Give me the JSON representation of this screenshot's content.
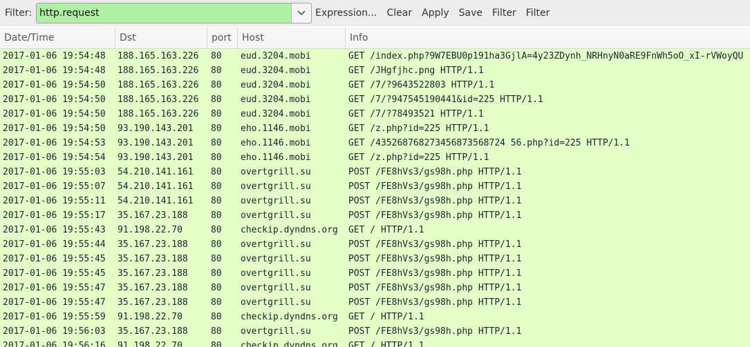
{
  "toolbar": {
    "filter_label": "Filter:",
    "filter_value": "http.request",
    "buttons": [
      "Expression...",
      "Clear",
      "Apply",
      "Save",
      "Filter",
      "Filter"
    ]
  },
  "columns": [
    "Date/Time",
    "Dst",
    "port",
    "Host",
    "Info"
  ],
  "rows": [
    [
      "2017-01-06 19:54:48",
      "188.165.163.226",
      "80",
      "eud.3204.mobi",
      "GET /index.php?9W7EBU0p191ha3GjlA=4y23ZDynh_NRHnyN0aRE9FnWh5oO_xI-rVWoyQU"
    ],
    [
      "2017-01-06 19:54:48",
      "188.165.163.226",
      "80",
      "eud.3204.mobi",
      "GET /JHgfjhc.png HTTP/1.1"
    ],
    [
      "2017-01-06 19:54:50",
      "188.165.163.226",
      "80",
      "eud.3204.mobi",
      "GET /7/?9643522803 HTTP/1.1"
    ],
    [
      "2017-01-06 19:54:50",
      "188.165.163.226",
      "80",
      "eud.3204.mobi",
      "GET /7/?947545190441&id=225 HTTP/1.1"
    ],
    [
      "2017-01-06 19:54:50",
      "188.165.163.226",
      "80",
      "eud.3204.mobi",
      "GET /7/?78493521 HTTP/1.1"
    ],
    [
      "2017-01-06 19:54:50",
      "93.190.143.201",
      "80",
      "eho.1146.mobi",
      "GET /z.php?id=225 HTTP/1.1"
    ],
    [
      "2017-01-06 19:54:53",
      "93.190.143.201",
      "80",
      "eho.1146.mobi",
      "GET /435268768273456873568724 56.php?id=225 HTTP/1.1"
    ],
    [
      "2017-01-06 19:54:54",
      "93.190.143.201",
      "80",
      "eho.1146.mobi",
      "GET /z.php?id=225 HTTP/1.1"
    ],
    [
      "2017-01-06 19:55:03",
      "54.210.141.161",
      "80",
      "overtgrill.su",
      "POST /FE8hVs3/gs98h.php HTTP/1.1"
    ],
    [
      "2017-01-06 19:55:07",
      "54.210.141.161",
      "80",
      "overtgrill.su",
      "POST /FE8hVs3/gs98h.php HTTP/1.1"
    ],
    [
      "2017-01-06 19:55:11",
      "54.210.141.161",
      "80",
      "overtgrill.su",
      "POST /FE8hVs3/gs98h.php HTTP/1.1"
    ],
    [
      "2017-01-06 19:55:17",
      "35.167.23.188",
      "80",
      "overtgrill.su",
      "POST /FE8hVs3/gs98h.php HTTP/1.1"
    ],
    [
      "2017-01-06 19:55:43",
      "91.198.22.70",
      "80",
      "checkip.dyndns.org",
      "GET / HTTP/1.1"
    ],
    [
      "2017-01-06 19:55:44",
      "35.167.23.188",
      "80",
      "overtgrill.su",
      "POST /FE8hVs3/gs98h.php HTTP/1.1"
    ],
    [
      "2017-01-06 19:55:45",
      "35.167.23.188",
      "80",
      "overtgrill.su",
      "POST /FE8hVs3/gs98h.php HTTP/1.1"
    ],
    [
      "2017-01-06 19:55:45",
      "35.167.23.188",
      "80",
      "overtgrill.su",
      "POST /FE8hVs3/gs98h.php HTTP/1.1"
    ],
    [
      "2017-01-06 19:55:47",
      "35.167.23.188",
      "80",
      "overtgrill.su",
      "POST /FE8hVs3/gs98h.php HTTP/1.1"
    ],
    [
      "2017-01-06 19:55:47",
      "35.167.23.188",
      "80",
      "overtgrill.su",
      "POST /FE8hVs3/gs98h.php HTTP/1.1"
    ],
    [
      "2017-01-06 19:55:59",
      "91.198.22.70",
      "80",
      "checkip.dyndns.org",
      "GET / HTTP/1.1"
    ],
    [
      "2017-01-06 19:56:03",
      "35.167.23.188",
      "80",
      "overtgrill.su",
      "POST /FE8hVs3/gs98h.php HTTP/1.1"
    ],
    [
      "2017-01-06 19:56:16",
      "91.198.22.70",
      "80",
      "checkip.dyndns.org",
      "GET / HTTP/1.1"
    ]
  ]
}
